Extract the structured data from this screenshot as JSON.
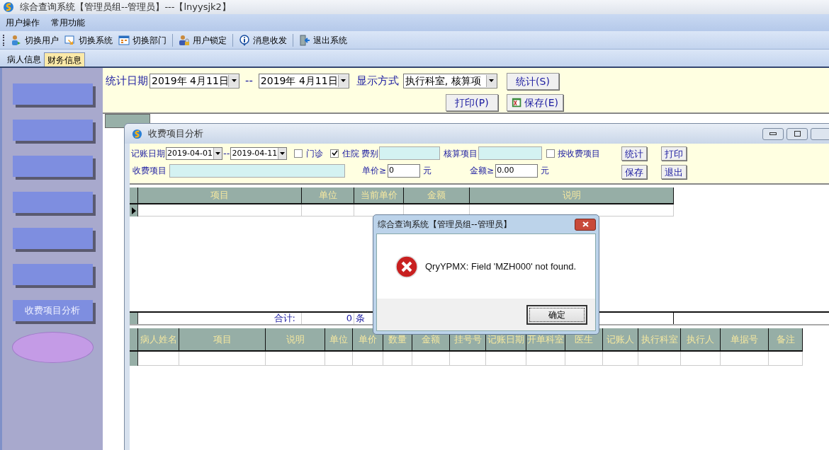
{
  "window": {
    "title": "综合查询系统【管理员组--管理员】---【lnyysjk2】"
  },
  "menu": [
    "用户操作",
    "常用功能"
  ],
  "toolbar": [
    {
      "label": "切换用户",
      "kind": "users"
    },
    {
      "label": "切换系统",
      "kind": "switch"
    },
    {
      "label": "切换部门",
      "kind": "calendar"
    },
    {
      "label": "用户锁定",
      "kind": "lock"
    },
    {
      "label": "消息收发",
      "kind": "info"
    },
    {
      "label": "退出系统",
      "kind": "exit"
    }
  ],
  "tabs": [
    {
      "label": "病人信息",
      "selected": false
    },
    {
      "label": "财务信息",
      "selected": true
    }
  ],
  "sidebar": {
    "items": [
      {
        "kind": "illegible"
      },
      {
        "kind": "illegible"
      },
      {
        "kind": "illegible"
      },
      {
        "kind": "illegible"
      },
      {
        "kind": "illegible"
      },
      {
        "kind": "illegible"
      },
      {
        "kind": "button",
        "label": "收费项目分析"
      },
      {
        "kind": "oval"
      }
    ]
  },
  "query_panel": {
    "date_label": "统计日期",
    "date_from": "2019年  4月11日",
    "separator": "--",
    "date_to": "2019年  4月11日",
    "mode_label": "显示方式",
    "mode": "执行科室, 核算项",
    "buttons": [
      "统计(S)",
      "打印(P)",
      "保存(E)"
    ]
  },
  "child_window": {
    "title": "收费项目分析",
    "filters": {
      "date_label": "记账日期",
      "date_from": "2019-04-01",
      "separator": "--",
      "date_to": "2019-04-11",
      "checkboxes": [
        {
          "label": "门诊",
          "checked": false
        },
        {
          "label": "住院",
          "checked": true
        }
      ],
      "fee_type_label": "费别",
      "account_item_label": "核算项目",
      "by_item": {
        "label": "按收费项目",
        "checked": false
      },
      "item_label": "收费项目",
      "price_label": "单价≥",
      "price": "0",
      "price_unit": "元",
      "amount_label": "金额≥",
      "amount": "0.00",
      "amount_unit": "元",
      "buttons": [
        "统计",
        "打印",
        "保存",
        "退出"
      ]
    },
    "upper_grid": {
      "columns": [
        "项目",
        "单位",
        "当前单价",
        "金额",
        "说明"
      ],
      "total_label": "合计:",
      "total_count": "0",
      "total_unit": "条"
    },
    "lower_grid": {
      "columns": [
        "病人姓名",
        "项目",
        "说明",
        "单位",
        "单价",
        "数量",
        "金额",
        "挂号号",
        "记账日期",
        "开单科室",
        "医生",
        "记账人",
        "执行科室",
        "执行人",
        "单据号",
        "备注"
      ]
    }
  },
  "dialog": {
    "title": "综合查询系统【管理员组--管理员】",
    "message": "QryYPMX: Field 'MZH000' not found.",
    "button": "确定"
  }
}
